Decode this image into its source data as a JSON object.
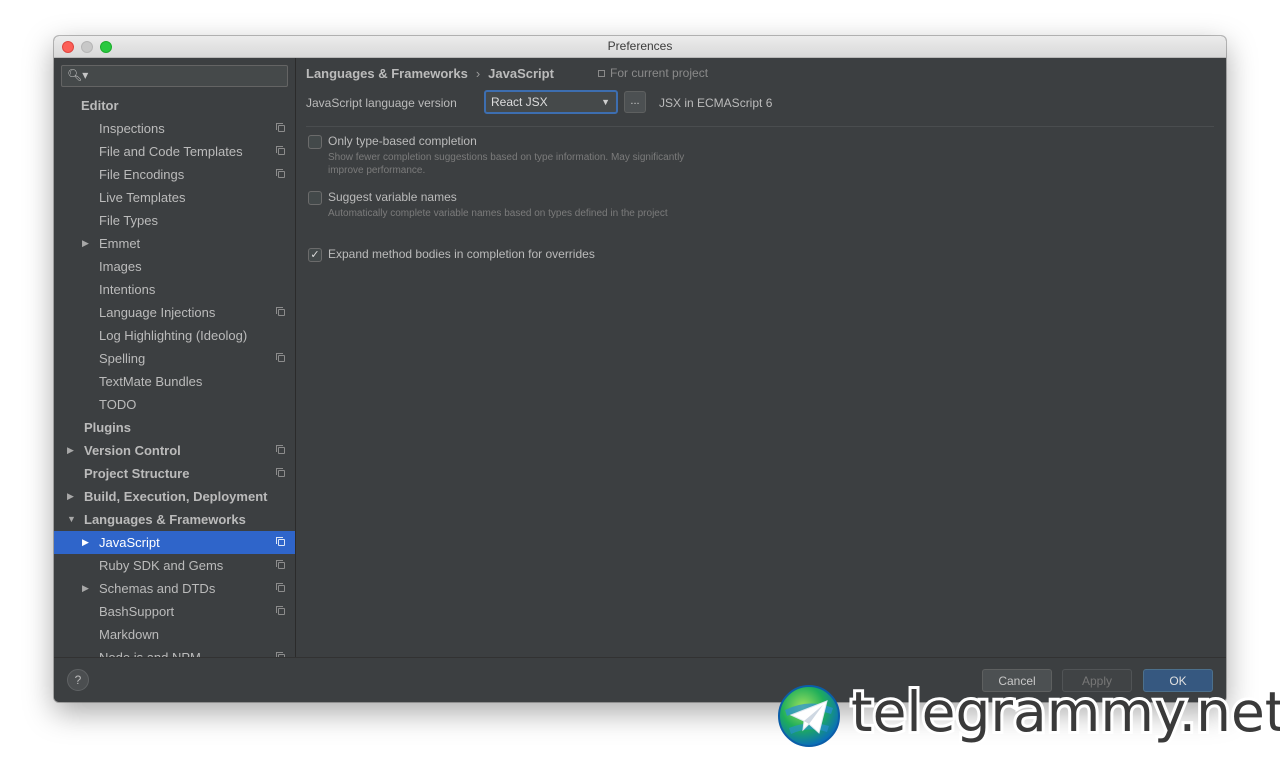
{
  "window": {
    "title": "Preferences"
  },
  "search": {
    "icon": "search-icon",
    "value": "",
    "placeholder": ""
  },
  "sidebar": {
    "items": [
      {
        "label": "Editor",
        "level": 0,
        "bold": true,
        "arrow": "",
        "project": false
      },
      {
        "label": "Inspections",
        "level": 1,
        "bold": false,
        "arrow": "",
        "project": true
      },
      {
        "label": "File and Code Templates",
        "level": 1,
        "bold": false,
        "arrow": "",
        "project": true
      },
      {
        "label": "File Encodings",
        "level": 1,
        "bold": false,
        "arrow": "",
        "project": true
      },
      {
        "label": "Live Templates",
        "level": 1,
        "bold": false,
        "arrow": "",
        "project": false
      },
      {
        "label": "File Types",
        "level": 1,
        "bold": false,
        "arrow": "",
        "project": false
      },
      {
        "label": "Emmet",
        "level": 1,
        "bold": false,
        "arrow": "▶",
        "project": false
      },
      {
        "label": "Images",
        "level": 1,
        "bold": false,
        "arrow": "",
        "project": false
      },
      {
        "label": "Intentions",
        "level": 1,
        "bold": false,
        "arrow": "",
        "project": false
      },
      {
        "label": "Language Injections",
        "level": 1,
        "bold": false,
        "arrow": "",
        "project": true
      },
      {
        "label": "Log Highlighting (Ideolog)",
        "level": 1,
        "bold": false,
        "arrow": "",
        "project": false
      },
      {
        "label": "Spelling",
        "level": 1,
        "bold": false,
        "arrow": "",
        "project": true
      },
      {
        "label": "TextMate Bundles",
        "level": 1,
        "bold": false,
        "arrow": "",
        "project": false
      },
      {
        "label": "TODO",
        "level": 1,
        "bold": false,
        "arrow": "",
        "project": false
      },
      {
        "label": "Plugins",
        "level": 0,
        "bold": true,
        "arrow": "",
        "project": false
      },
      {
        "label": "Version Control",
        "level": 0,
        "bold": true,
        "arrow": "▶",
        "project": true
      },
      {
        "label": "Project Structure",
        "level": 0,
        "bold": true,
        "arrow": "",
        "project": true
      },
      {
        "label": "Build, Execution, Deployment",
        "level": 0,
        "bold": true,
        "arrow": "▶",
        "project": false
      },
      {
        "label": "Languages & Frameworks",
        "level": 0,
        "bold": true,
        "arrow": "▼",
        "project": false
      },
      {
        "label": "JavaScript",
        "level": 1,
        "bold": false,
        "arrow": "▶",
        "project": true,
        "selected": true
      },
      {
        "label": "Ruby SDK and Gems",
        "level": 1,
        "bold": false,
        "arrow": "",
        "project": true
      },
      {
        "label": "Schemas and DTDs",
        "level": 1,
        "bold": false,
        "arrow": "▶",
        "project": true
      },
      {
        "label": "BashSupport",
        "level": 1,
        "bold": false,
        "arrow": "",
        "project": true
      },
      {
        "label": "Markdown",
        "level": 1,
        "bold": false,
        "arrow": "",
        "project": false
      },
      {
        "label": "Node.js and NPM",
        "level": 1,
        "bold": false,
        "arrow": "",
        "project": true
      }
    ]
  },
  "breadcrumb": {
    "parent": "Languages & Frameworks",
    "separator": "›",
    "current": "JavaScript",
    "scope": "For current project"
  },
  "js_version": {
    "label": "JavaScript language version",
    "selected": "React JSX",
    "more_button": "...",
    "description": "JSX in ECMAScript 6"
  },
  "options": [
    {
      "title": "Only type-based completion",
      "description": "Show fewer completion suggestions based on type information. May significantly improve performance.",
      "checked": false
    },
    {
      "title": "Suggest variable names",
      "description": "Automatically complete variable names based on types defined in the project",
      "checked": false
    },
    {
      "title": "Expand method bodies in completion for overrides",
      "description": "",
      "checked": true
    }
  ],
  "footer": {
    "help": "?",
    "cancel": "Cancel",
    "apply": "Apply",
    "ok": "OK"
  },
  "watermark": {
    "text": "telegrammy.net"
  },
  "colors": {
    "background": "#3c3f41",
    "selection": "#2f65ca",
    "ok_button": "#365880",
    "text": "#bbbbbb"
  }
}
